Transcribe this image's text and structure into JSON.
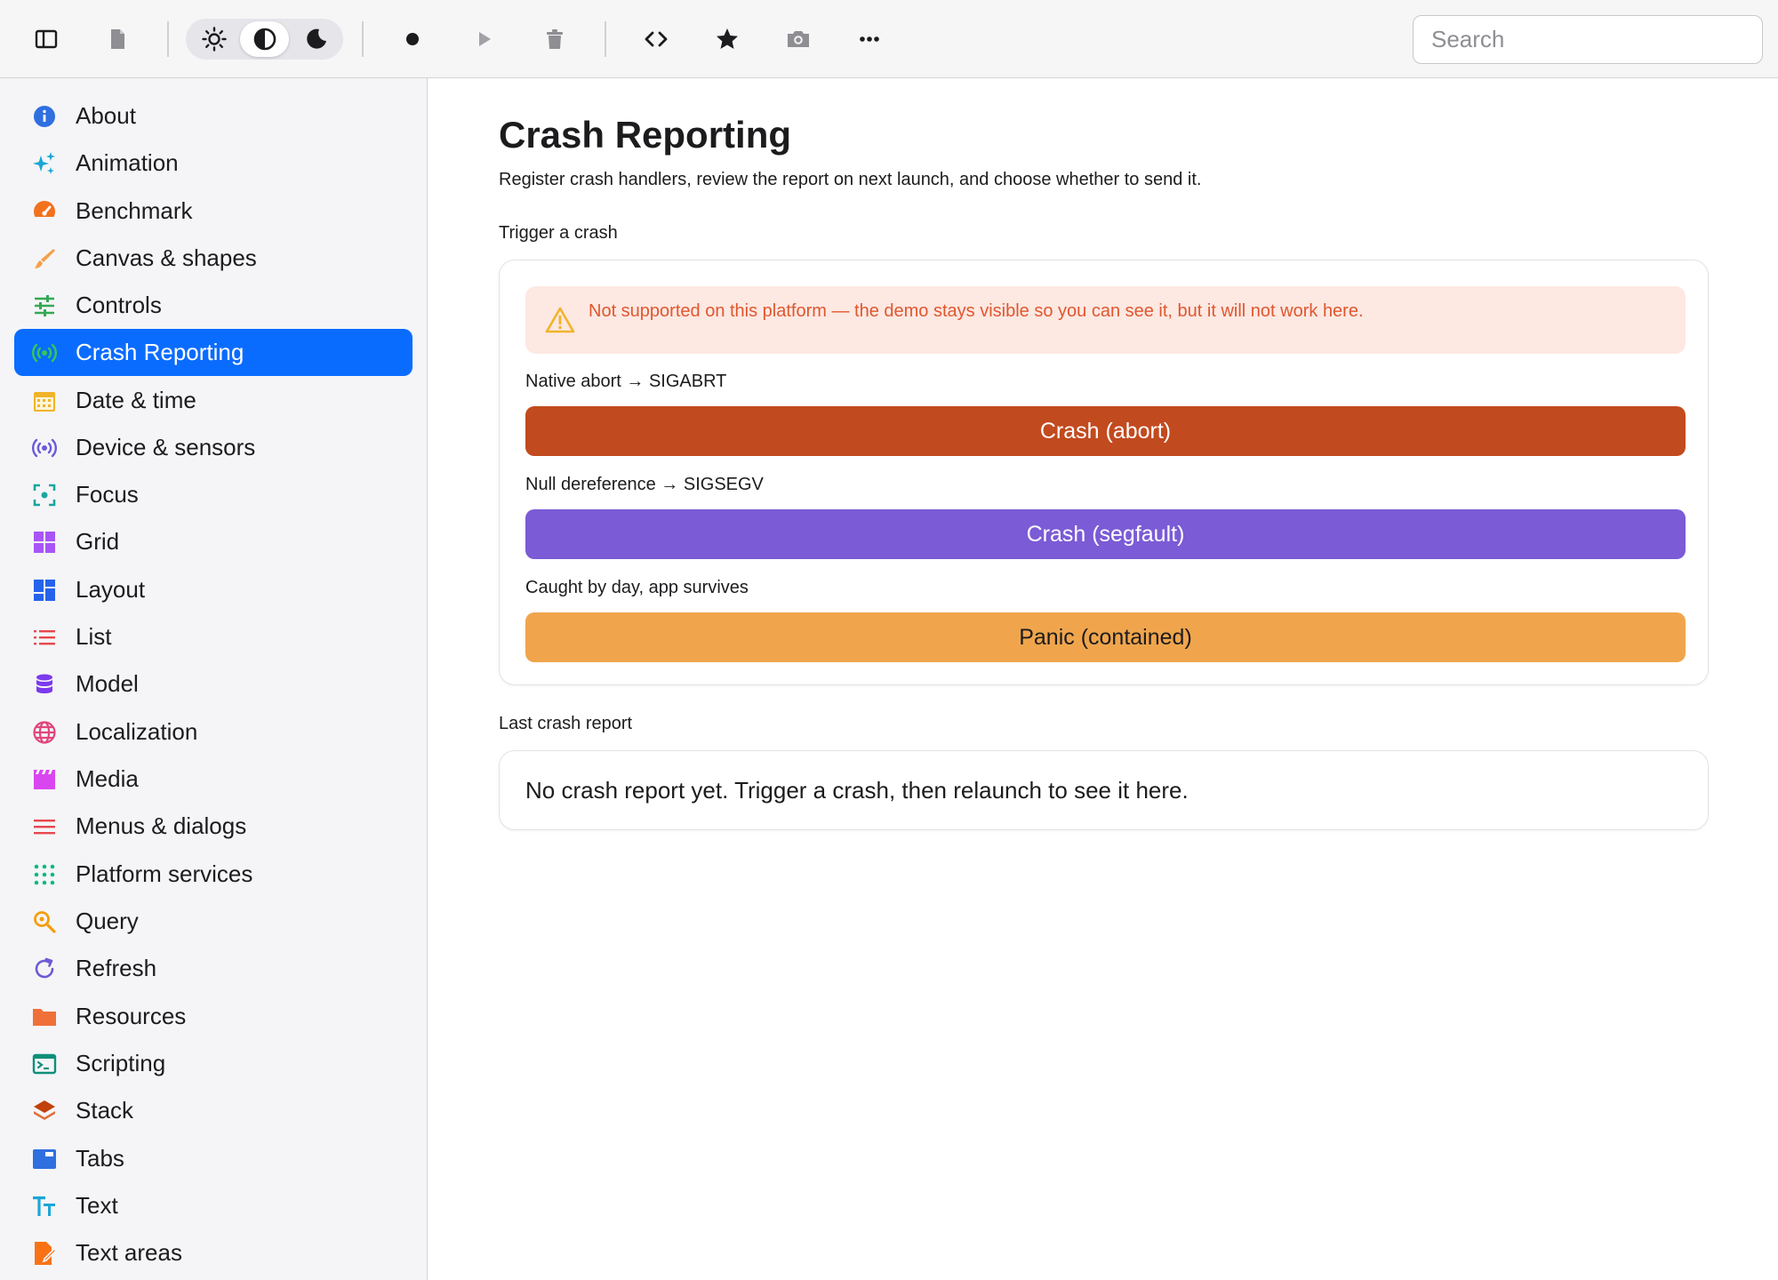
{
  "toolbar": {
    "icons": [
      "sidebar-toggle-icon",
      "document-icon",
      "sun-icon",
      "half-circle-icon",
      "moon-icon",
      "record-icon",
      "play-icon",
      "trash-icon",
      "code-icon",
      "star-icon",
      "camera-icon",
      "more-icon"
    ],
    "theme_selected": "auto",
    "search": {
      "placeholder": "Search",
      "value": ""
    }
  },
  "sidebar": {
    "items": [
      {
        "label": "About",
        "icon": "info-icon",
        "color": "#2f6fe0"
      },
      {
        "label": "Animation",
        "icon": "sparkles-icon",
        "color": "#1aa6d6"
      },
      {
        "label": "Benchmark",
        "icon": "gauge-icon",
        "color": "#f2711c"
      },
      {
        "label": "Canvas & shapes",
        "icon": "brush-icon",
        "color": "#f5a04a"
      },
      {
        "label": "Controls",
        "icon": "sliders-icon",
        "color": "#34a853"
      },
      {
        "label": "Crash Reporting",
        "icon": "broadcast-icon",
        "color": "#34c759",
        "active": true
      },
      {
        "label": "Date & time",
        "icon": "calendar-icon",
        "color": "#f0b429"
      },
      {
        "label": "Device & sensors",
        "icon": "sensor-icon",
        "color": "#6b5bd6"
      },
      {
        "label": "Focus",
        "icon": "focus-icon",
        "color": "#1aa6a0"
      },
      {
        "label": "Grid",
        "icon": "grid-icon",
        "color": "#a855f7"
      },
      {
        "label": "Layout",
        "icon": "layout-icon",
        "color": "#2563eb"
      },
      {
        "label": "List",
        "icon": "list-icon",
        "color": "#e5484d"
      },
      {
        "label": "Model",
        "icon": "database-icon",
        "color": "#7c3aed"
      },
      {
        "label": "Localization",
        "icon": "globe-icon",
        "color": "#e0457b"
      },
      {
        "label": "Media",
        "icon": "clapper-icon",
        "color": "#d946ef"
      },
      {
        "label": "Menus & dialogs",
        "icon": "menu-icon",
        "color": "#e5484d"
      },
      {
        "label": "Platform services",
        "icon": "apps-icon",
        "color": "#10b981"
      },
      {
        "label": "Query",
        "icon": "magnifier-icon",
        "color": "#f59e0b"
      },
      {
        "label": "Refresh",
        "icon": "refresh-icon",
        "color": "#6b5bd6"
      },
      {
        "label": "Resources",
        "icon": "folder-icon",
        "color": "#f0703a"
      },
      {
        "label": "Scripting",
        "icon": "terminal-icon",
        "color": "#0f8f7a"
      },
      {
        "label": "Stack",
        "icon": "layers-icon",
        "color": "#c2410c"
      },
      {
        "label": "Tabs",
        "icon": "tabs-icon",
        "color": "#2f6fe0"
      },
      {
        "label": "Text",
        "icon": "text-icon",
        "color": "#1aa6d6"
      },
      {
        "label": "Text areas",
        "icon": "edit-doc-icon",
        "color": "#f97316"
      }
    ]
  },
  "main": {
    "title": "Crash Reporting",
    "subtitle": "Register crash handlers, review the report on next launch, and choose whether to send it.",
    "trigger_section": {
      "label": "Trigger a crash",
      "warning": "Not supported on this platform — the demo stays visible so you can see it, but it will not work here.",
      "demos": [
        {
          "label": "Native abort → SIGABRT",
          "button": "Crash (abort)",
          "color": "#c24a1f"
        },
        {
          "label": "Null dereference → SIGSEGV",
          "button": "Crash (segfault)",
          "color": "#7b5bd6"
        },
        {
          "label": "Caught by day, app survives",
          "button": "Panic (contained)",
          "color": "#f0a54c"
        }
      ]
    },
    "report_section": {
      "label": "Last crash report",
      "text": "No crash report yet. Trigger a crash, then relaunch to see it here."
    }
  }
}
